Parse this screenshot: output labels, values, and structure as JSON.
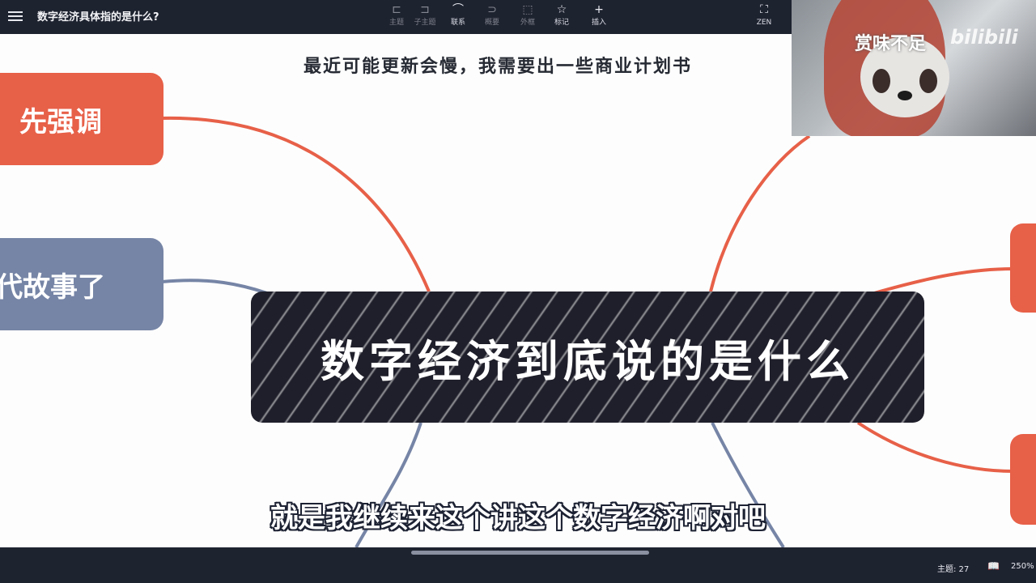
{
  "app": {
    "doc_title": "数字经济具体指的是什么?",
    "toolbar": [
      {
        "icon": "topic-icon",
        "glyph": "⊏",
        "label": "主题"
      },
      {
        "icon": "subtopic-icon",
        "glyph": "⊐",
        "label": "子主题"
      },
      {
        "icon": "relationship-icon",
        "glyph": "⌒",
        "label": "联系"
      },
      {
        "icon": "summary-icon",
        "glyph": "⊃",
        "label": "概要"
      },
      {
        "icon": "boundary-icon",
        "glyph": "⬚",
        "label": "外框"
      },
      {
        "icon": "marker-icon",
        "glyph": "☆",
        "label": "标记"
      },
      {
        "icon": "insert-icon",
        "glyph": "+",
        "label": "插入"
      }
    ],
    "zen_label": "ZEN"
  },
  "canvas": {
    "notice": "最近可能更新会慢，我需要出一些商业计划书",
    "central_topic": "数字经济到底说的是什么",
    "branches": {
      "left_top": "先强调",
      "left_mid": "代故事了"
    },
    "subtitle": "就是我继续来这个讲这个数字经济啊对吧"
  },
  "webcam": {
    "overlay_text": "赏味不足",
    "logo_text": "bilibili"
  },
  "statusbar": {
    "topic_count": "主题: 27",
    "zoom": "250%"
  },
  "colors": {
    "toolbar_bg": "#1e2330",
    "branch_red": "#e76048",
    "branch_blue": "#7685a6",
    "central_bg": "#1f1f2b"
  }
}
